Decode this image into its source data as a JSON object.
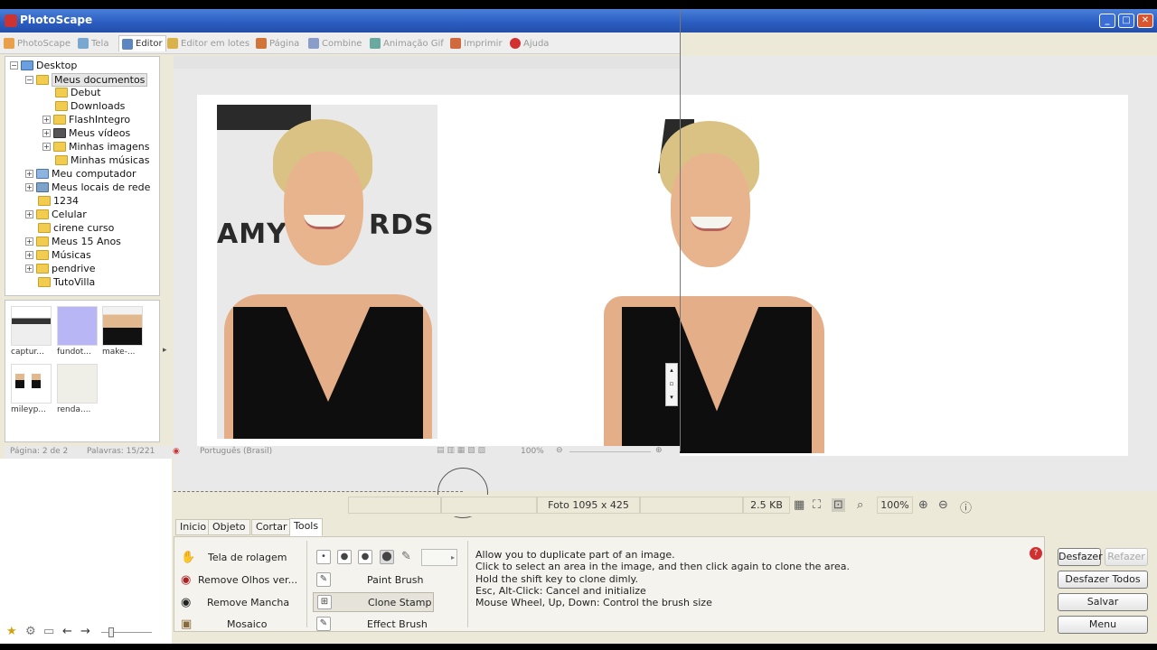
{
  "window": {
    "title": "PhotoScape"
  },
  "tabs": [
    {
      "label": "PhotoScape",
      "icon": "photoscape-icon",
      "active": false
    },
    {
      "label": "Tela",
      "icon": "screen-icon",
      "active": false
    },
    {
      "label": "Editor",
      "icon": "editor-icon",
      "active": true
    },
    {
      "label": "Editor em lotes",
      "icon": "batch-editor-icon",
      "active": false
    },
    {
      "label": "Página",
      "icon": "page-icon",
      "active": false
    },
    {
      "label": "Combine",
      "icon": "combine-icon",
      "active": false
    },
    {
      "label": "Animação Gif",
      "icon": "gif-icon",
      "active": false
    },
    {
      "label": "Imprimir",
      "icon": "print-icon",
      "active": false
    },
    {
      "label": "Ajuda",
      "icon": "help-icon",
      "active": false
    }
  ],
  "tree": [
    {
      "label": "Desktop",
      "level": 0
    },
    {
      "label": "Meus documentos",
      "level": 1
    },
    {
      "label": "Debut",
      "level": 2
    },
    {
      "label": "Downloads",
      "level": 2
    },
    {
      "label": "FlashIntegro",
      "level": 2
    },
    {
      "label": "Meus vídeos",
      "level": 2
    },
    {
      "label": "Minhas imagens",
      "level": 2
    },
    {
      "label": "Minhas músicas",
      "level": 2
    },
    {
      "label": "Meu computador",
      "level": 1
    },
    {
      "label": "Meus locais de rede",
      "level": 1
    },
    {
      "label": "1234",
      "level": 1
    },
    {
      "label": "Celular",
      "level": 1
    },
    {
      "label": "cirene curso",
      "level": 1
    },
    {
      "label": "Meus 15 Anos",
      "level": 1
    },
    {
      "label": "Músicas",
      "level": 1
    },
    {
      "label": "pendrive",
      "level": 1
    },
    {
      "label": "TutoVilla",
      "level": 1
    }
  ],
  "thumbnails": [
    {
      "label": "captur..."
    },
    {
      "label": "fundot..."
    },
    {
      "label": "make-..."
    },
    {
      "label": "mileyp..."
    },
    {
      "label": "renda...."
    }
  ],
  "word_status": {
    "page": "Página: 2 de 2",
    "words": "Palavras: 15/221",
    "language": "Português (Brasil)",
    "zoom": "100%"
  },
  "photo_text": {
    "left_banner": "AMY",
    "right_banner": "RDS"
  },
  "status": {
    "photo_size": "Foto 1095 x 425",
    "file_size": "2.5 KB",
    "zoom": "100%"
  },
  "subtabs": [
    "Inicio",
    "Objeto",
    "Cortar",
    "Tools"
  ],
  "left_tools": [
    {
      "label": "Tela de rolagem",
      "icon": "hand-icon"
    },
    {
      "label": "Remove Olhos ver...",
      "icon": "red-eye-icon"
    },
    {
      "label": "Remove Mancha",
      "icon": "mole-icon"
    },
    {
      "label": "Mosaico",
      "icon": "mosaic-icon"
    }
  ],
  "brush_tools": [
    {
      "label": "Paint Brush",
      "icon": "paint-brush-icon"
    },
    {
      "label": "Clone Stamp",
      "icon": "clone-stamp-icon"
    },
    {
      "label": "Effect Brush",
      "icon": "effect-brush-icon"
    }
  ],
  "description": "Allow you to duplicate part of an image.\nClick to select an area in the image, and then click again to clone the area.\nHold the shift key to clone dimly.\nEsc, Alt-Click: Cancel and initialize\nMouse Wheel, Up, Down: Control the brush size",
  "actions": {
    "undo": "Desfazer",
    "redo": "Refazer",
    "undo_all": "Desfazer Todos",
    "save": "Salvar",
    "menu": "Menu"
  }
}
